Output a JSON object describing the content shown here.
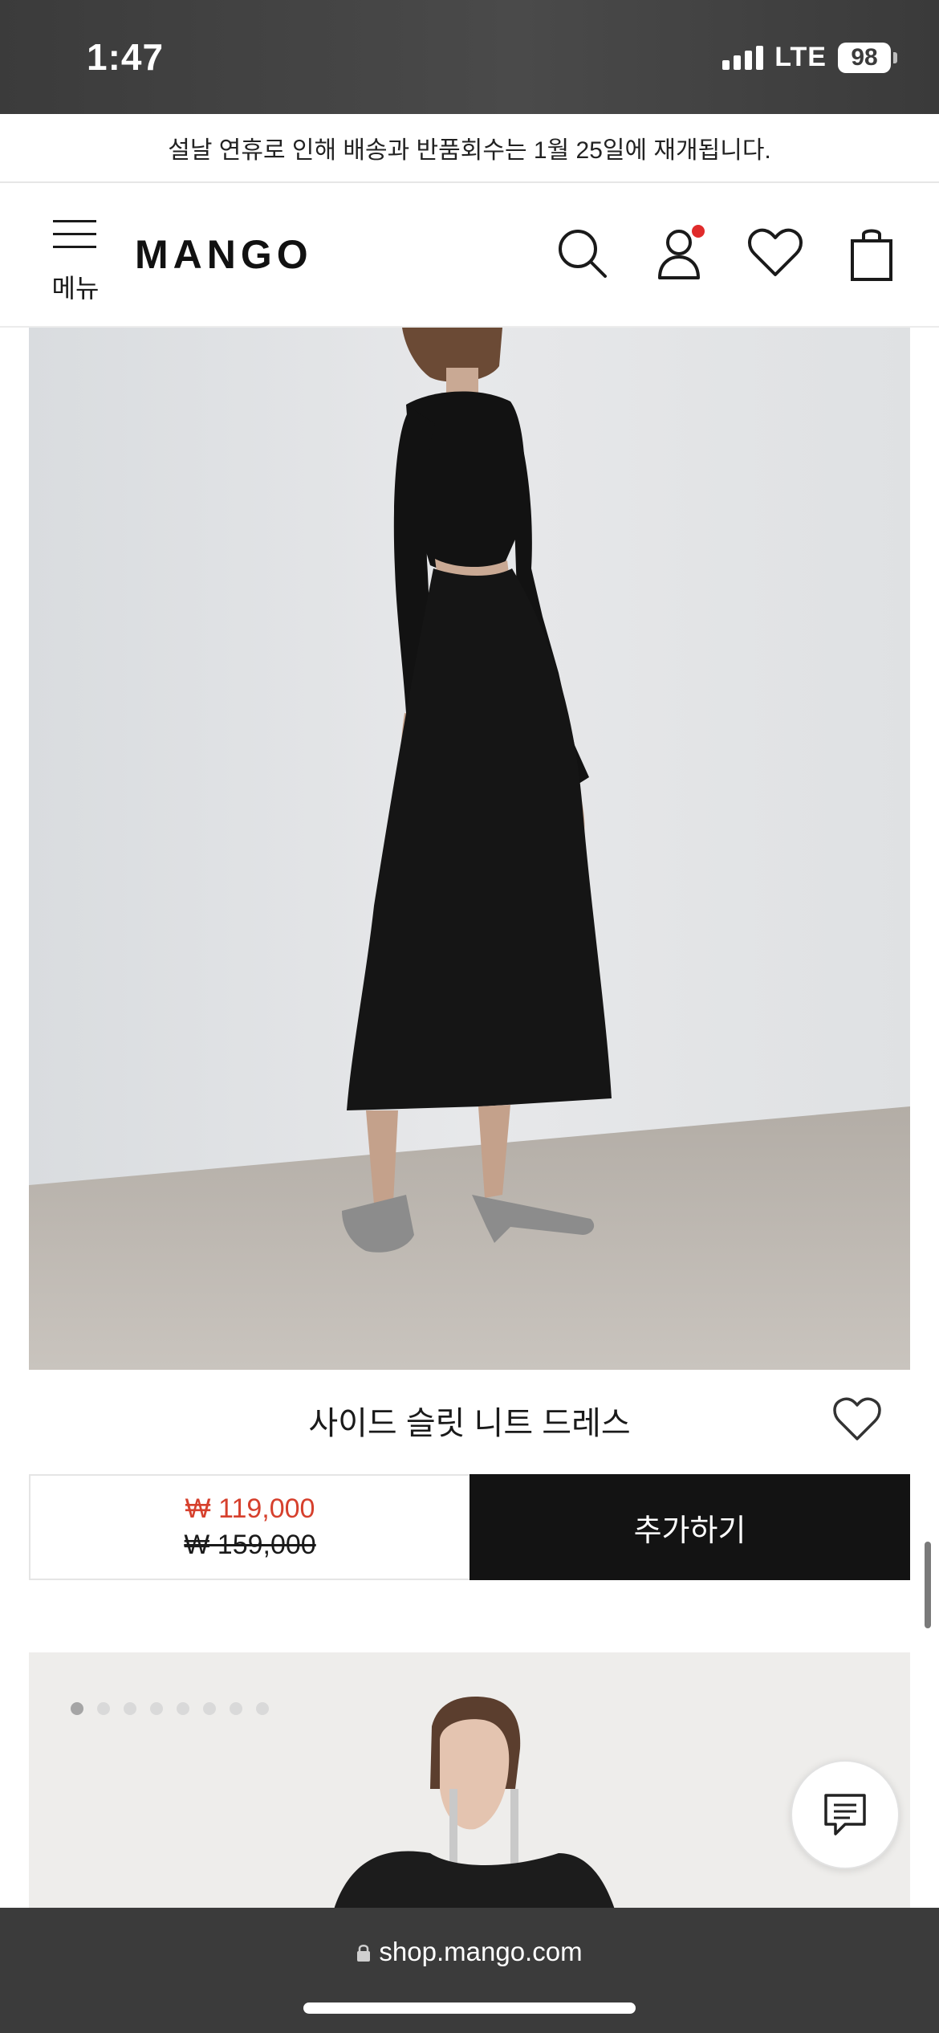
{
  "status_bar": {
    "time": "1:47",
    "network": "LTE",
    "battery": "98"
  },
  "announcement": {
    "text": "설날 연휴로 인해 배송과 반품회수는 1월 25일에 재개됩니다."
  },
  "header": {
    "menu_label": "메뉴",
    "logo": "MANGO",
    "icons": [
      "search-icon",
      "account-icon",
      "wishlist-icon",
      "shopping-bag-icon"
    ],
    "account_notification_color": "#e02b2b"
  },
  "products": [
    {
      "name": "사이드 슬릿 니트 드레스",
      "sale_price": "₩ 119,000",
      "original_price": "₩ 159,000",
      "add_button_label": "추가하기",
      "sale_color": "#d6402d"
    }
  ],
  "carousel": {
    "dot_count": 8,
    "active_index": 0
  },
  "browser": {
    "url": "shop.mango.com"
  }
}
